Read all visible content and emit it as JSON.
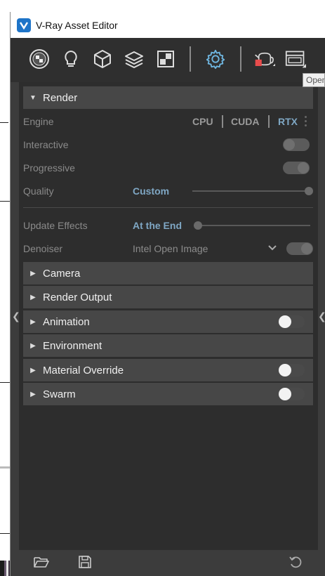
{
  "window": {
    "title": "V-Ray Asset Editor"
  },
  "toolbar": {
    "icons": [
      "materials-icon",
      "lights-icon",
      "geometry-icon",
      "layers-icon",
      "textures-icon",
      "settings-icon",
      "render-teapot-icon",
      "frame-buffer-icon"
    ]
  },
  "tooltip": {
    "text": "Open"
  },
  "render": {
    "title": "Render",
    "engine_label": "Engine",
    "engine_options": [
      "CPU",
      "CUDA",
      "RTX"
    ],
    "engine_selected": "RTX",
    "interactive_label": "Interactive",
    "interactive_on": false,
    "progressive_label": "Progressive",
    "progressive_on": true,
    "quality_label": "Quality",
    "quality_value": "Custom",
    "quality_slider": 1.0,
    "update_effects_label": "Update Effects",
    "update_effects_value": "At the End",
    "update_effects_slider": 0.0,
    "denoiser_label": "Denoiser",
    "denoiser_value": "Intel Open Image",
    "denoiser_on": true
  },
  "sections": [
    {
      "title": "Camera",
      "has_toggle": false
    },
    {
      "title": "Render Output",
      "has_toggle": false
    },
    {
      "title": "Animation",
      "has_toggle": true,
      "on": false
    },
    {
      "title": "Environment",
      "has_toggle": false
    },
    {
      "title": "Material Override",
      "has_toggle": true,
      "on": false
    },
    {
      "title": "Swarm",
      "has_toggle": true,
      "on": false
    }
  ],
  "colors": {
    "accent": "#7fa7c4",
    "panel": "#2d2d2d",
    "section_header": "#474747",
    "settings_icon": "#6fb6e0",
    "render_icon_red": "#e84c4c"
  }
}
